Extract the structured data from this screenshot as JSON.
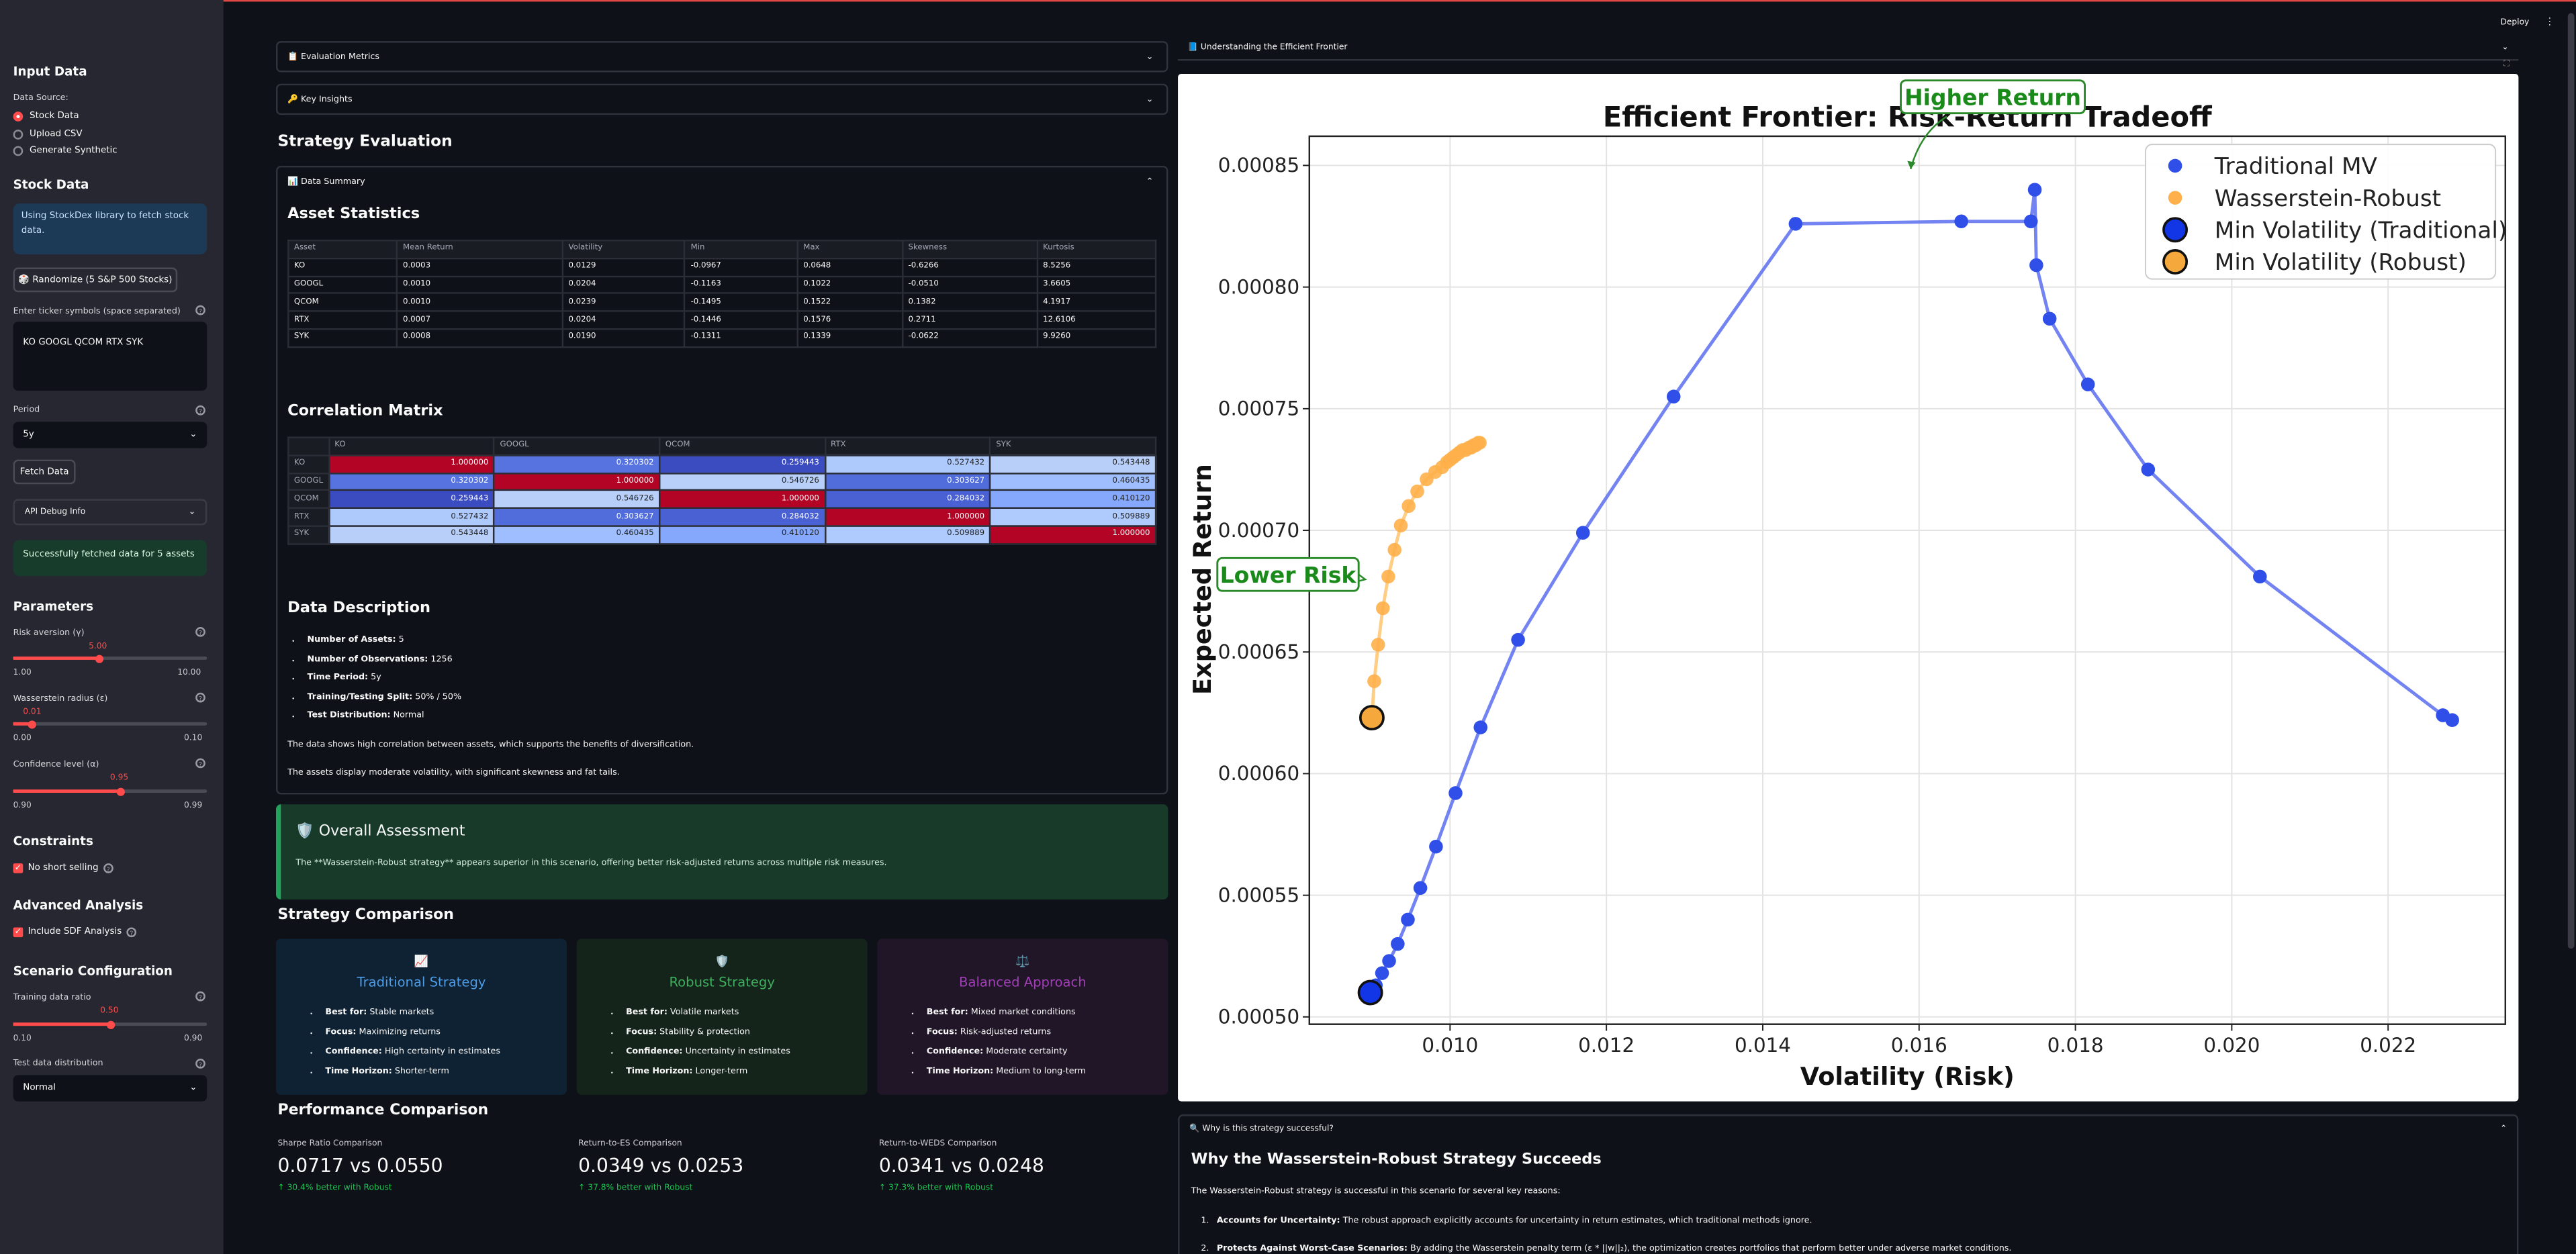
{
  "header": {
    "deploy_label": "Deploy",
    "menu_icon": "kebab-menu-icon"
  },
  "sidebar": {
    "input_data_heading": "Input Data",
    "data_source_label": "Data Source:",
    "data_source_options": [
      "Stock Data",
      "Upload CSV",
      "Generate Synthetic"
    ],
    "data_source_selected": "Stock Data",
    "stock_data_heading": "Stock Data",
    "info_text": "Using StockDex library to fetch stock data.",
    "randomize_button": "🎲 Randomize (5 S&P 500 Stocks)",
    "tickers_label": "Enter ticker symbols (space separated)",
    "tickers_value": "KO GOOGL QCOM RTX SYK",
    "period_label": "Period",
    "period_value": "5y",
    "fetch_button": "Fetch Data",
    "api_debug_label": "API Debug Info",
    "success_text": "Successfully fetched data for 5 assets",
    "parameters_heading": "Parameters",
    "risk_aversion": {
      "label": "Risk aversion (γ)",
      "value": "5.00",
      "min": "1.00",
      "max": "10.00",
      "fraction": 0.444
    },
    "wasserstein_radius": {
      "label": "Wasserstein radius (ε)",
      "value": "0.01",
      "min": "0.00",
      "max": "0.10",
      "fraction": 0.1
    },
    "confidence_level": {
      "label": "Confidence level (α)",
      "value": "0.95",
      "min": "0.90",
      "max": "0.99",
      "fraction": 0.556
    },
    "constraints_heading": "Constraints",
    "no_short_label": "No short selling",
    "advanced_heading": "Advanced Analysis",
    "sdf_label": "Include SDF Analysis",
    "scenario_heading": "Scenario Configuration",
    "training_ratio": {
      "label": "Training data ratio",
      "value": "0.50",
      "min": "0.10",
      "max": "0.90",
      "fraction": 0.5
    },
    "test_dist_label": "Test data distribution",
    "test_dist_value": "Normal"
  },
  "main": {
    "eval_metrics_label": "📋 Evaluation Metrics",
    "key_insights_label": "🔑 Key Insights",
    "strategy_eval_heading": "Strategy Evaluation",
    "data_summary_label": "📊 Data Summary",
    "asset_stats_heading": "Asset Statistics",
    "asset_stats": {
      "columns": [
        "Asset",
        "Mean Return",
        "Volatility",
        "Min",
        "Max",
        "Skewness",
        "Kurtosis"
      ],
      "rows": [
        [
          "KO",
          "0.0003",
          "0.0129",
          "-0.0967",
          "0.0648",
          "-0.6266",
          "8.5256"
        ],
        [
          "GOOGL",
          "0.0010",
          "0.0204",
          "-0.1163",
          "0.1022",
          "-0.0510",
          "3.6605"
        ],
        [
          "QCOM",
          "0.0010",
          "0.0239",
          "-0.1495",
          "0.1522",
          "0.1382",
          "4.1917"
        ],
        [
          "RTX",
          "0.0007",
          "0.0204",
          "-0.1446",
          "0.1576",
          "0.2711",
          "12.6106"
        ],
        [
          "SYK",
          "0.0008",
          "0.0190",
          "-0.1311",
          "0.1339",
          "-0.0622",
          "9.9260"
        ]
      ]
    },
    "corr_heading": "Correlation Matrix",
    "corr": {
      "labels": [
        "KO",
        "GOOGL",
        "QCOM",
        "RTX",
        "SYK"
      ],
      "values": [
        [
          "1.000000",
          "0.320302",
          "0.259443",
          "0.527432",
          "0.543448"
        ],
        [
          "0.320302",
          "1.000000",
          "0.546726",
          "0.303627",
          "0.460435"
        ],
        [
          "0.259443",
          "0.546726",
          "1.000000",
          "0.284032",
          "0.410120"
        ],
        [
          "0.527432",
          "0.303627",
          "0.284032",
          "1.000000",
          "0.509889"
        ],
        [
          "0.543448",
          "0.460435",
          "0.410120",
          "0.509889",
          "1.000000"
        ]
      ],
      "colors": [
        [
          "#b40426",
          "#5673e0",
          "#3b4cc0",
          "#aec9fc",
          "#b7cff9"
        ],
        [
          "#5673e0",
          "#b40426",
          "#b7cff9",
          "#516ddb",
          "#9ebeff"
        ],
        [
          "#3b4cc0",
          "#b7cff9",
          "#b40426",
          "#4961d2",
          "#85a8fc"
        ],
        [
          "#aec9fc",
          "#516ddb",
          "#4961d2",
          "#b40426",
          "#afcafc"
        ],
        [
          "#b7cff9",
          "#9ebeff",
          "#85a8fc",
          "#afcafc",
          "#b40426"
        ]
      ]
    },
    "data_desc_heading": "Data Description",
    "data_desc": [
      {
        "k": "Number of Assets:",
        "v": " 5"
      },
      {
        "k": "Number of Observations:",
        "v": " 1256"
      },
      {
        "k": "Time Period:",
        "v": " 5y"
      },
      {
        "k": "Training/Testing Split:",
        "v": " 50% / 50%"
      },
      {
        "k": "Test Distribution:",
        "v": " Normal"
      }
    ],
    "desc_p1": "The data shows high correlation between assets, which supports the benefits of diversification.",
    "desc_p2": "The assets display moderate volatility, with significant skewness and fat tails.",
    "assessment_heading": "🛡️ Overall Assessment",
    "assessment_text": "The **Wasserstein-Robust strategy** appears superior in this scenario, offering better risk-adjusted returns across multiple risk measures.",
    "strategy_comp_heading": "Strategy Comparison",
    "cards": [
      {
        "icon": "📈",
        "title": "Traditional Strategy",
        "color": "#4d9ce6",
        "bg": "#0f2233",
        "items": [
          {
            "k": "Best for:",
            "v": " Stable markets"
          },
          {
            "k": "Focus:",
            "v": " Maximizing returns"
          },
          {
            "k": "Confidence:",
            "v": " High certainty in estimates"
          },
          {
            "k": "Time Horizon:",
            "v": " Shorter-term"
          }
        ]
      },
      {
        "icon": "🛡️",
        "title": "Robust Strategy",
        "color": "#3fae5e",
        "bg": "#14241a",
        "items": [
          {
            "k": "Best for:",
            "v": " Volatile markets"
          },
          {
            "k": "Focus:",
            "v": " Stability & protection"
          },
          {
            "k": "Confidence:",
            "v": " Uncertainty in estimates"
          },
          {
            "k": "Time Horizon:",
            "v": " Longer-term"
          }
        ]
      },
      {
        "icon": "⚖️",
        "title": "Balanced Approach",
        "color": "#a03fb6",
        "bg": "#211628",
        "items": [
          {
            "k": "Best for:",
            "v": " Mixed market conditions"
          },
          {
            "k": "Focus:",
            "v": " Risk-adjusted returns"
          },
          {
            "k": "Confidence:",
            "v": " Moderate certainty"
          },
          {
            "k": "Time Horizon:",
            "v": " Medium to long-term"
          }
        ]
      }
    ],
    "perf_heading": "Performance Comparison",
    "metrics": [
      {
        "label": "Sharpe Ratio Comparison",
        "value": "0.0717 vs 0.0550",
        "delta": "↑ 30.4% better with Robust"
      },
      {
        "label": "Return-to-ES Comparison",
        "value": "0.0349 vs 0.0253",
        "delta": "↑ 37.8% better with Robust"
      },
      {
        "label": "Return-to-WEDS Comparison",
        "value": "0.0341 vs 0.0248",
        "delta": "↑ 37.3% better with Robust"
      }
    ]
  },
  "right": {
    "understanding_label": "📘 Understanding the Efficient Frontier",
    "why_label": "🔍 Why is this strategy successful?",
    "why_heading": "Why the Wasserstein-Robust Strategy Succeeds",
    "why_intro": "The Wasserstein-Robust strategy is successful in this scenario for several key reasons:",
    "why_items": [
      {
        "k": "Accounts for Uncertainty:",
        "v": " The robust approach explicitly accounts for uncertainty in return estimates, which traditional methods ignore."
      },
      {
        "k": "Protects Against Worst-Case Scenarios:",
        "v": " By adding the Wasserstein penalty term (ε * ||w||₂), the optimization creates portfolios that perform better under adverse market conditions."
      }
    ]
  },
  "chart_data": {
    "type": "scatter",
    "title": "Efficient Frontier: Risk-Return Tradeoff",
    "xlabel": "Volatility (Risk)",
    "ylabel": "Expected Return",
    "xlim": [
      0.0082,
      0.0235
    ],
    "ylim": [
      0.000497,
      0.000862
    ],
    "xticks": [
      "0.010",
      "0.012",
      "0.014",
      "0.016",
      "0.018",
      "0.020",
      "0.022"
    ],
    "yticks": [
      "0.00050",
      "0.00055",
      "0.00060",
      "0.00065",
      "0.00070",
      "0.00075",
      "0.00080",
      "0.00085"
    ],
    "grid": true,
    "legend_position": "top-right",
    "annotations": [
      {
        "text": "Higher Return"
      },
      {
        "text": "Lower Risk"
      }
    ],
    "series": [
      {
        "name": "Traditional MV",
        "color": "#2f4fe8",
        "x": [
          0.00898,
          0.00905,
          0.00913,
          0.00922,
          0.00933,
          0.00946,
          0.00962,
          0.00982,
          0.01007,
          0.01039,
          0.01087,
          0.0117,
          0.01286,
          0.01442,
          0.01654,
          0.01743,
          0.01748,
          0.0175,
          0.01767,
          0.01816,
          0.01893,
          0.02036,
          0.0227,
          0.02282
        ],
        "y": [
          0.00051,
          0.000513,
          0.000518,
          0.000523,
          0.00053,
          0.00054,
          0.000553,
          0.00057,
          0.000592,
          0.000619,
          0.000655,
          0.000699,
          0.000755,
          0.000826,
          0.000827,
          0.000827,
          0.00084,
          0.000809,
          0.000787,
          0.00076,
          0.000725,
          0.000681,
          0.000624,
          0.000622
        ]
      },
      {
        "name": "Wasserstein-Robust",
        "color": "#ffb04a",
        "x": [
          0.009,
          0.00903,
          0.00908,
          0.00914,
          0.00921,
          0.00929,
          0.00937,
          0.00947,
          0.00958,
          0.0097,
          0.00981,
          0.0099,
          0.00996,
          0.01,
          0.01004,
          0.01008,
          0.01012,
          0.01016,
          0.0102,
          0.01024,
          0.01027,
          0.0103,
          0.01033,
          0.01036,
          0.01038
        ],
        "y": [
          0.000623,
          0.000638,
          0.000653,
          0.000668,
          0.000681,
          0.000692,
          0.000702,
          0.00071,
          0.000716,
          0.000721,
          0.000724,
          0.000726,
          0.000728,
          0.000729,
          0.00073,
          0.000731,
          0.000732,
          0.000733,
          0.000733,
          0.000734,
          0.000734,
          0.000735,
          0.000735,
          0.000736,
          0.000736
        ]
      },
      {
        "name": "Min Volatility (Traditional)",
        "color": "#1236e6",
        "x": [
          0.00898
        ],
        "y": [
          0.00051
        ]
      },
      {
        "name": "Min Volatility (Robust)",
        "color": "#f5a83c",
        "x": [
          0.009
        ],
        "y": [
          0.000623
        ]
      }
    ]
  }
}
